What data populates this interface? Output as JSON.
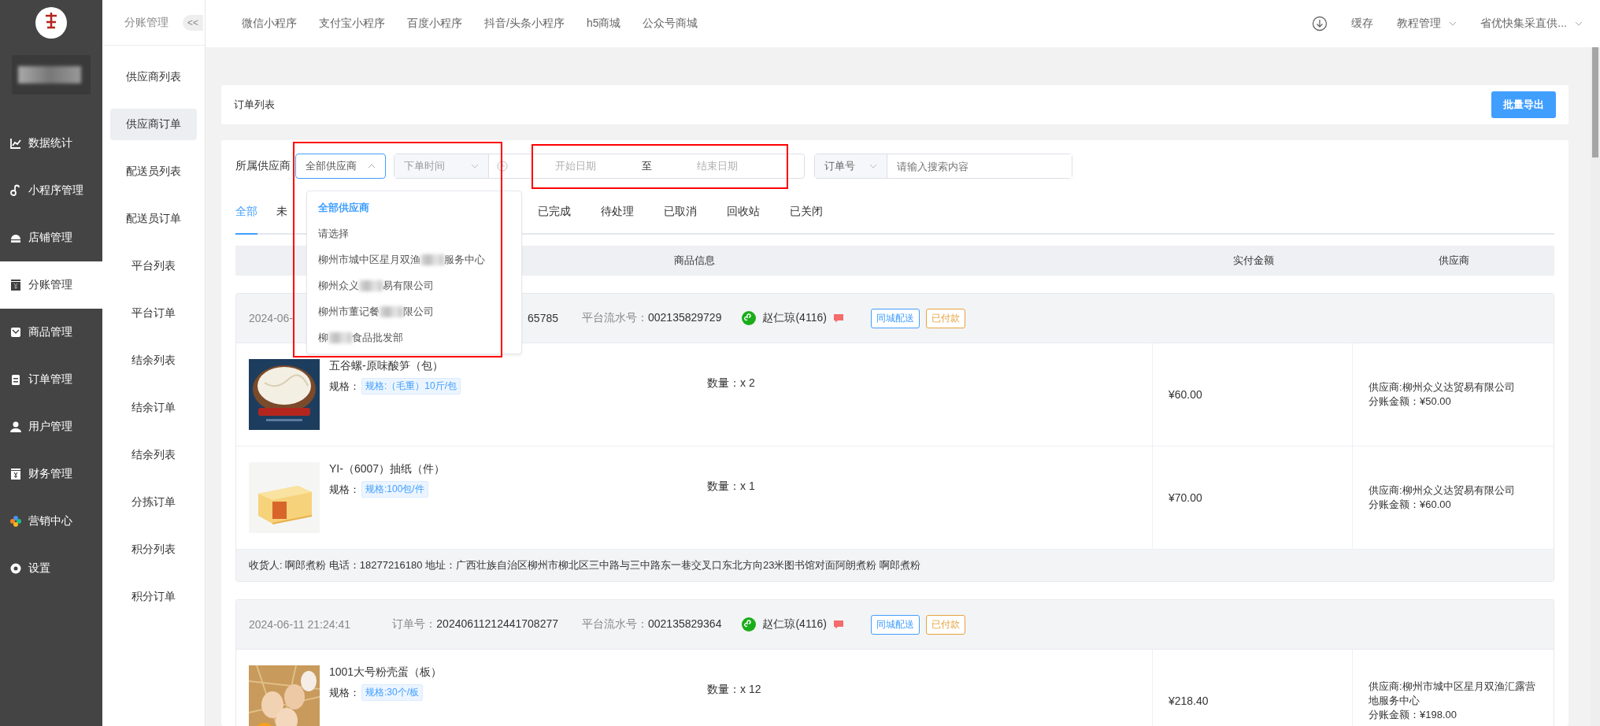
{
  "sidebar": {
    "menu": [
      {
        "label": "数据统计",
        "selected": false
      },
      {
        "label": "小程序管理",
        "selected": false
      },
      {
        "label": "店铺管理",
        "selected": false
      },
      {
        "label": "分账管理",
        "selected": true
      },
      {
        "label": "商品管理",
        "selected": false
      },
      {
        "label": "订单管理",
        "selected": false
      },
      {
        "label": "用户管理",
        "selected": false
      },
      {
        "label": "财务管理",
        "selected": false
      },
      {
        "label": "营销中心",
        "selected": false
      },
      {
        "label": "设置",
        "selected": false
      }
    ]
  },
  "subnav": {
    "title": "分账管理",
    "collapse": "<<",
    "items": [
      {
        "label": "供应商列表",
        "selected": false
      },
      {
        "label": "供应商订单",
        "selected": true
      },
      {
        "label": "配送员列表",
        "selected": false
      },
      {
        "label": "配送员订单",
        "selected": false
      },
      {
        "label": "平台列表",
        "selected": false
      },
      {
        "label": "平台订单",
        "selected": false
      },
      {
        "label": "结余列表",
        "selected": false
      },
      {
        "label": "结余订单",
        "selected": false
      },
      {
        "label": "结余列表",
        "selected": false
      },
      {
        "label": "分拣订单",
        "selected": false
      },
      {
        "label": "积分列表",
        "selected": false
      },
      {
        "label": "积分订单",
        "selected": false
      }
    ]
  },
  "topbar": {
    "channels": [
      "微信小程序",
      "支付宝小程序",
      "百度小程序",
      "抖音/头条小程序",
      "h5商城",
      "公众号商城"
    ],
    "cache": "缓存",
    "tutorial": "教程管理",
    "account": "省优快集采直供..."
  },
  "page_header": {
    "title": "订单列表",
    "export": "批量导出"
  },
  "filters": {
    "supplier_label": "所属供应商",
    "supplier_value": "全部供应商",
    "time_type": "下单时间",
    "start_placeholder": "开始日期",
    "to": "至",
    "end_placeholder": "结束日期",
    "search_type": "订单号",
    "search_placeholder": "请输入搜索内容"
  },
  "supplier_dropdown": {
    "options": [
      {
        "text": "全部供应商",
        "selected": true
      },
      {
        "text": "请选择",
        "selected": false
      },
      {
        "text": "柳州市城中区星月双渔",
        "text_after_blur": "服务中心",
        "selected": false
      },
      {
        "text": "柳州众义",
        "text_after_blur": "易有限公司",
        "selected": false
      },
      {
        "text": "柳州市董记餐",
        "text_after_blur": "限公司",
        "selected": false
      },
      {
        "text": "柳",
        "text_after_blur": "食品批发部",
        "selected": false
      }
    ]
  },
  "status_tabs": [
    {
      "label": "全部",
      "selected": true
    },
    {
      "label": "未",
      "selected": false
    },
    {
      "label": "已完成",
      "selected": false
    },
    {
      "label": "待处理",
      "selected": false
    },
    {
      "label": "已取消",
      "selected": false
    },
    {
      "label": "回收站",
      "selected": false
    },
    {
      "label": "已关闭",
      "selected": false
    }
  ],
  "table": {
    "columns": [
      "商品信息",
      "实付金额",
      "供应商"
    ]
  },
  "orders": [
    {
      "time": "2024-06-",
      "order_no": "65785",
      "serial_label": "平台流水号：",
      "serial": "002135829729",
      "buyer": "赵仁琼(4116)",
      "tags": [
        {
          "label": "同城配送",
          "color": "#409eff"
        },
        {
          "label": "已付款",
          "color": "#e6a23c"
        }
      ],
      "items": [
        {
          "name": "五谷螺-原味酸笋（包）",
          "spec_label": "规格：",
          "spec": "规格:（毛重）10斤/包",
          "quantity": "数量：x 2",
          "amount": "¥60.00",
          "supplier_lines": [
            "供应商:柳州众义达贸易有限公司",
            "分账金额：¥50.00"
          ]
        },
        {
          "name": "YI-（6007）抽纸（件）",
          "spec_label": "规格：",
          "spec": "规格:100包/件",
          "quantity": "数量：x 1",
          "amount": "¥70.00",
          "supplier_lines": [
            "供应商:柳州众义达贸易有限公司",
            "分账金额：¥60.00"
          ]
        }
      ],
      "address": "收货人: 啊郎煮粉 电话：18277216180 地址：广西壮族自治区柳州市柳北区三中路与三中路东一巷交叉口东北方向23米图书馆对面阿朗煮粉 啊郎煮粉"
    },
    {
      "time": "2024-06-11 21:24:41",
      "order_no_label": "订单号：",
      "order_no": "20240611212441708277",
      "serial_label": "平台流水号：",
      "serial": "002135829364",
      "buyer": "赵仁琼(4116)",
      "tags": [
        {
          "label": "同城配送",
          "color": "#409eff"
        },
        {
          "label": "已付款",
          "color": "#e6a23c"
        }
      ],
      "items": [
        {
          "name": "1001大号粉壳蛋（板）",
          "spec_label": "规格：",
          "spec": "规格:30个/板",
          "quantity": "数量：x 12",
          "amount": "¥218.40",
          "supplier_lines": [
            "供应商:柳州市城中区星月双渔汇露营地服务中心",
            "分账金额：¥198.00"
          ]
        }
      ]
    }
  ]
}
